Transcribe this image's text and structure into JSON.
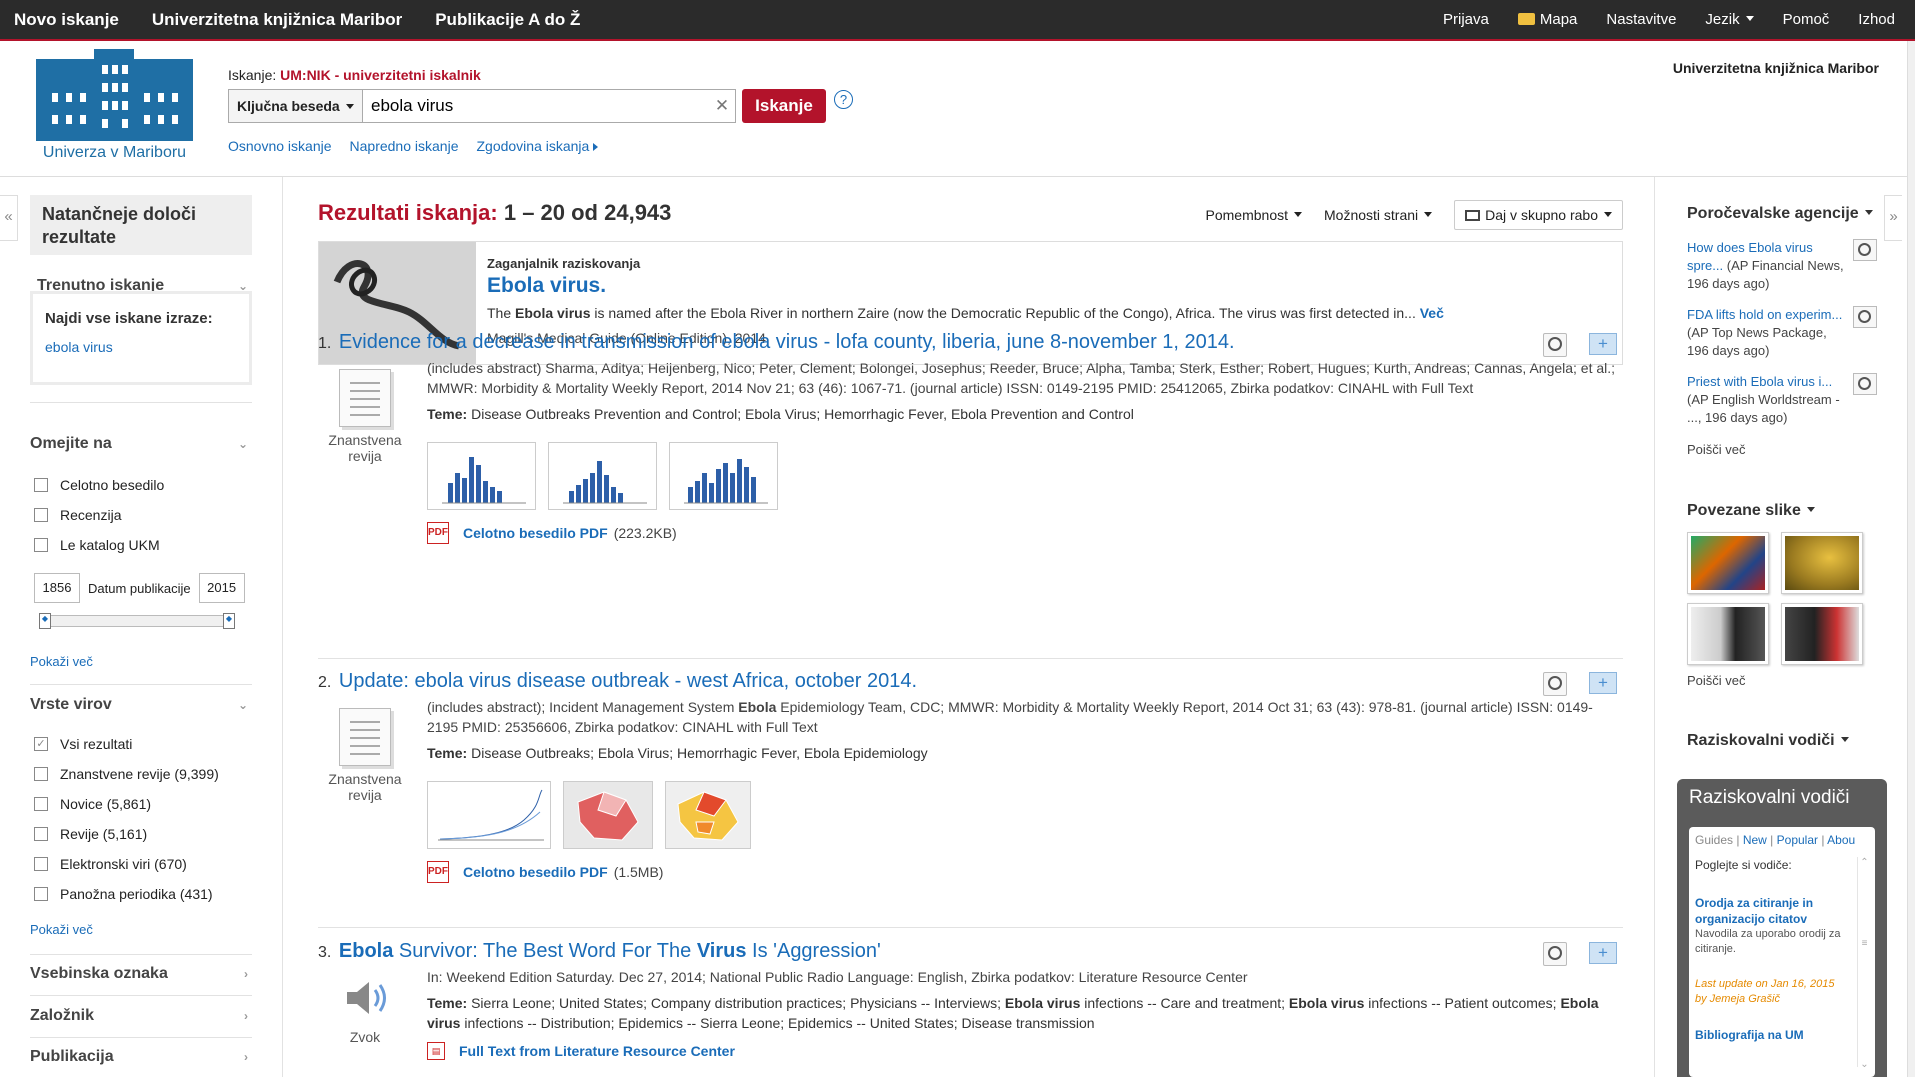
{
  "topbar": {
    "left": [
      "Novo iskanje",
      "Univerzitetna knjižnica Maribor",
      "Publikacije A do Ž"
    ],
    "right": {
      "login": "Prijava",
      "folder": "Mapa",
      "settings": "Nastavitve",
      "language": "Jezik",
      "help": "Pomoč",
      "exit": "Izhod"
    }
  },
  "header": {
    "logo_caption": "Univerza v Mariboru",
    "search_label_prefix": "Iskanje:",
    "search_label_name": "UM:NIK - univerzitetni iskalnik",
    "search_type": "Ključna beseda",
    "search_value": "ebola virus",
    "search_button": "Iskanje",
    "help_glyph": "?",
    "links": [
      "Osnovno iskanje",
      "Napredno iskanje",
      "Zgodovina iskanja"
    ],
    "library_name": "Univerzitetna knjižnica Maribor"
  },
  "left": {
    "refine_title": "Natančneje določi rezultate",
    "current_search_heading": "Trenutno iskanje",
    "find_all_label": "Najdi vse iskane izraze:",
    "find_all_term": "ebola virus",
    "limit_heading": "Omejite na",
    "limits": [
      "Celotno besedilo",
      "Recenzija",
      "Le katalog UKM"
    ],
    "date_from": "1856",
    "date_label": "Datum publikacije",
    "date_to": "2015",
    "show_more": "Pokaži več",
    "source_types_heading": "Vrste virov",
    "source_types": [
      {
        "label": "Vsi rezultati",
        "count": "",
        "checked": true
      },
      {
        "label": "Znanstvene revije",
        "count": "(9,399)",
        "checked": false
      },
      {
        "label": "Novice",
        "count": "(5,861)",
        "checked": false
      },
      {
        "label": "Revije",
        "count": "(5,161)",
        "checked": false
      },
      {
        "label": "Elektronski viri",
        "count": "(670)",
        "checked": false
      },
      {
        "label": "Panožna periodika",
        "count": "(431)",
        "checked": false
      }
    ],
    "show_more_2": "Pokaži več",
    "collapsed_sections": [
      "Vsebinska oznaka",
      "Založnik",
      "Publikacija"
    ]
  },
  "main": {
    "results_label": "Rezultati iskanja:",
    "results_count": "1 – 20 od 24,943",
    "sort": "Pomembnost",
    "page_options": "Možnosti strani",
    "share": "Daj v skupno rabo",
    "topic": {
      "kicker": "Zaganjalnik raziskovanja",
      "title": "Ebola virus.",
      "desc_pre": "The ",
      "desc_bold": "Ebola virus",
      "desc_post": " is named after the Ebola River in northern Zaire (now the Democratic Republic of the Congo), Africa. The virus was first detected in...",
      "more": "Več",
      "source": "Magill's Medical Guide (Online Edition), 2014"
    },
    "results": [
      {
        "num": "1.",
        "title": "Evidence for a decrease in transmission of ebola virus - lofa county, liberia, june 8-november 1, 2014.",
        "type": "Znanstvena revija",
        "details": "(includes abstract) Sharma, Aditya; Heijenberg, Nico; Peter, Clement; Bolongei, Josephus; Reeder, Bruce; Alpha, Tamba; Sterk, Esther; Robert, Hugues; Kurth, Andreas; Cannas, Angela; et al.; MMWR: Morbidity & Mortality Weekly Report, 2014 Nov 21; 63 (46): 1067-71. (journal article) ISSN: 0149-2195 PMID: 25412065, Zbirka podatkov: CINAHL with Full Text",
        "teme_label": "Teme:",
        "teme": " Disease Outbreaks Prevention and Control; Ebola Virus; Hemorrhagic Fever, Ebola Prevention and Control",
        "pdf_label": "Celotno besedilo PDF",
        "pdf_size": "(223.2KB)"
      },
      {
        "num": "2.",
        "title": "Update: ebola virus disease outbreak - west Africa, october 2014.",
        "type": "Znanstvena revija",
        "details_pre": "(includes abstract); Incident Management System ",
        "details_bold": "Ebola",
        "details_post": " Epidemiology Team, CDC; MMWR: Morbidity & Mortality Weekly Report, 2014 Oct 31; 63 (43): 978-81. (journal article) ISSN: 0149-2195 PMID: 25356606, Zbirka podatkov: CINAHL with Full Text",
        "teme_label": "Teme:",
        "teme": " Disease Outbreaks; Ebola Virus; Hemorrhagic Fever, Ebola Epidemiology",
        "pdf_label": "Celotno besedilo PDF",
        "pdf_size": "(1.5MB)"
      },
      {
        "num": "3.",
        "title_b1": "Ebola",
        "title_m": " Survivor: The Best Word For The ",
        "title_b2": "Virus",
        "title_e": " Is 'Aggression'",
        "type": "Zvok",
        "details": "In: Weekend Edition Saturday. Dec 27, 2014; National Public Radio Language: English, Zbirka podatkov: Literature Resource Center",
        "teme_label": "Teme:",
        "teme_p1": " Sierra Leone; United States; Company distribution practices; Physicians -- Interviews; ",
        "teme_b1": "Ebola virus",
        "teme_p2": " infections -- Care and treatment; ",
        "teme_b2": "Ebola virus",
        "teme_p3": " infections -- Patient outcomes; ",
        "teme_b3": "Ebola virus",
        "teme_p4": " infections -- Distribution; Epidemics -- Sierra Leone; Epidemics -- United States; Disease transmission",
        "fulltext": "Full Text from Literature Resource Center"
      }
    ]
  },
  "right": {
    "news_heading": "Poročevalske agencije",
    "news": [
      {
        "link": "How does Ebola virus spre...",
        "meta": "(AP Financial News, 196 days ago)"
      },
      {
        "link": "FDA lifts hold on experim...",
        "meta": "(AP Top News Package, 196 days ago)"
      },
      {
        "link": "Priest with Ebola virus i...",
        "meta": "(AP English Worldstream - ..., 196 days ago)"
      }
    ],
    "search_more": "Poišči več",
    "images_heading": "Povezane slike",
    "images_more": "Poišči več",
    "guides_heading": "Raziskovalni vodiči",
    "guides_box_title": "Raziskovalni vodiči",
    "guides_tabs": {
      "guides": "Guides",
      "new": "New",
      "popular": "Popular",
      "about": "Abou"
    },
    "guides_intro": "Poglejte si vodiče:",
    "guide1_title": "Orodja za citiranje in organizacijo citatov",
    "guide1_desc": "Navodila za uporabo orodij za citiranje.",
    "guide_update": "Last update on Jan 16, 2015 by Jemeja Grašič",
    "guide2_title": "Bibliografija na UM"
  },
  "colors": {
    "accent_red": "#b3132b",
    "link_blue": "#1a6cb8",
    "topbar": "#2b2b2b"
  }
}
